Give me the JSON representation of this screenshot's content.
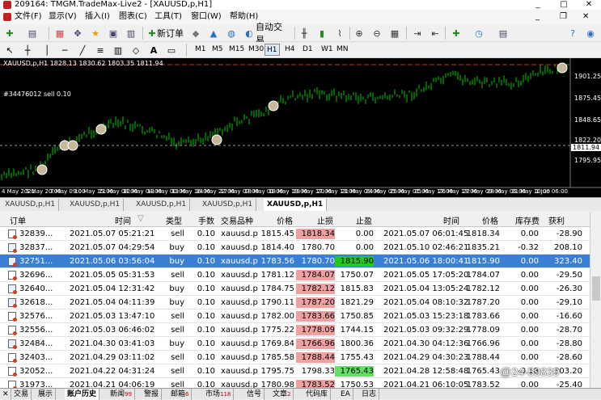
{
  "window": {
    "title": "209164: TMGM.TradeMax-Live2 - [XAUUSD,p,H1]",
    "controls": [
      "_",
      "□",
      "✕"
    ]
  },
  "menu": [
    "文件(F)",
    "显示(V)",
    "插入(I)",
    "图表(C)",
    "工具(T)",
    "窗口(W)",
    "帮助(H)"
  ],
  "toolbar": {
    "new_order": "新订单",
    "auto_trading": "自动交易"
  },
  "timeframes": [
    "M1",
    "M5",
    "M15",
    "M30",
    "H1",
    "H4",
    "D1",
    "W1",
    "MN"
  ],
  "active_timeframe": "H1",
  "chart": {
    "symbol_label": "XAUUSD,p,H1  1828.13 1830.62 1803.35 1811.94",
    "order_label": "#34476012 sell 0.10",
    "price_axis": [
      "1901.25",
      "1875.45",
      "1848.65",
      "1822.20",
      "1811.94",
      "1795.95"
    ],
    "time_axis": [
      "4 May 2021",
      "5 May 20:00",
      "7 May 09:00",
      "10 May 15:00",
      "11 May 08:00",
      "12 May 04:00",
      "13 May 00:00",
      "13 May 16:00",
      "14 May 22:00",
      "17 May 07:00",
      "18 May 01:00",
      "18 May 19:00",
      "19 May 17:00",
      "20 May 13:00",
      "21 May 09:00",
      "24 May 05:00",
      "25 May 01:00",
      "25 May 17:00",
      "26 May 13:00",
      "27 May 09:00",
      "28 May 05:00",
      "31 May 10:00",
      "1 Jun 06:00"
    ],
    "colors": {
      "candle": "#00c800",
      "current_price": "#ffffff",
      "order_line": "#d03030"
    }
  },
  "chart_tabs": [
    "XAUUSD,p,H1",
    "XAUUSD,p,H1",
    "XAUUSD,p,H1",
    "XAUUSD,p,H1",
    "XAUUSD,p,H1"
  ],
  "history": {
    "headers": [
      "订单",
      "时间",
      "类型",
      "手数",
      "交易品种",
      "价格",
      "止损",
      "止盈",
      "时间",
      "价格",
      "库存费",
      "获利"
    ],
    "rows": [
      {
        "order": "32839...",
        "open_time": "2021.05.07 05:21:21",
        "type": "sell",
        "lots": "0.10",
        "symbol": "xauusd.p",
        "price": "1815.45",
        "sl": "1818.34",
        "tp": "0.00",
        "close_time": "2021.05.07 06:01:45",
        "close_price": "1818.34",
        "swap": "0.00",
        "profit": "-28.90",
        "sl_hl": "red",
        "tp_hl": "",
        "sel": false
      },
      {
        "order": "32837...",
        "open_time": "2021.05.07 04:29:54",
        "type": "buy",
        "lots": "0.10",
        "symbol": "xauusd.p",
        "price": "1814.40",
        "sl": "1780.70",
        "tp": "0.00",
        "close_time": "2021.05.10 02:46:21",
        "close_price": "1835.21",
        "swap": "-0.32",
        "profit": "208.10",
        "sl_hl": "",
        "tp_hl": "",
        "sel": false
      },
      {
        "order": "32751...",
        "open_time": "2021.05.06 03:56:04",
        "type": "buy",
        "lots": "0.10",
        "symbol": "xauusd.p",
        "price": "1783.56",
        "sl": "1780.70",
        "tp": "1815.90",
        "close_time": "2021.05.06 18:00:41",
        "close_price": "1815.90",
        "swap": "0.00",
        "profit": "323.40",
        "sl_hl": "",
        "tp_hl": "green",
        "sel": true
      },
      {
        "order": "32696...",
        "open_time": "2021.05.05 05:31:53",
        "type": "sell",
        "lots": "0.10",
        "symbol": "xauusd.p",
        "price": "1781.12",
        "sl": "1784.07",
        "tp": "1750.07",
        "close_time": "2021.05.05 17:05:20",
        "close_price": "1784.07",
        "swap": "0.00",
        "profit": "-29.50",
        "sl_hl": "red",
        "tp_hl": "",
        "sel": false
      },
      {
        "order": "32640...",
        "open_time": "2021.05.04 12:31:42",
        "type": "buy",
        "lots": "0.10",
        "symbol": "xauusd.p",
        "price": "1784.75",
        "sl": "1782.12",
        "tp": "1815.83",
        "close_time": "2021.05.04 13:05:24",
        "close_price": "1782.12",
        "swap": "0.00",
        "profit": "-26.30",
        "sl_hl": "red",
        "tp_hl": "",
        "sel": false
      },
      {
        "order": "32618...",
        "open_time": "2021.05.04 04:11:39",
        "type": "buy",
        "lots": "0.10",
        "symbol": "xauusd.p",
        "price": "1790.11",
        "sl": "1787.20",
        "tp": "1821.29",
        "close_time": "2021.05.04 08:10:32",
        "close_price": "1787.20",
        "swap": "0.00",
        "profit": "-29.10",
        "sl_hl": "red",
        "tp_hl": "",
        "sel": false
      },
      {
        "order": "32576...",
        "open_time": "2021.05.03 13:47:10",
        "type": "sell",
        "lots": "0.10",
        "symbol": "xauusd.p",
        "price": "1782.00",
        "sl": "1783.66",
        "tp": "1750.85",
        "close_time": "2021.05.03 15:23:18",
        "close_price": "1783.66",
        "swap": "0.00",
        "profit": "-16.60",
        "sl_hl": "red",
        "tp_hl": "",
        "sel": false
      },
      {
        "order": "32556...",
        "open_time": "2021.05.03 06:46:02",
        "type": "sell",
        "lots": "0.10",
        "symbol": "xauusd.p",
        "price": "1775.22",
        "sl": "1778.09",
        "tp": "1744.15",
        "close_time": "2021.05.03 09:32:29",
        "close_price": "1778.09",
        "swap": "0.00",
        "profit": "-28.70",
        "sl_hl": "red",
        "tp_hl": "",
        "sel": false
      },
      {
        "order": "32484...",
        "open_time": "2021.04.30 03:41:03",
        "type": "buy",
        "lots": "0.10",
        "symbol": "xauusd.p",
        "price": "1769.84",
        "sl": "1766.96",
        "tp": "1800.36",
        "close_time": "2021.04.30 04:12:36",
        "close_price": "1766.96",
        "swap": "0.00",
        "profit": "-28.80",
        "sl_hl": "red",
        "tp_hl": "",
        "sel": false
      },
      {
        "order": "32403...",
        "open_time": "2021.04.29 03:11:02",
        "type": "sell",
        "lots": "0.10",
        "symbol": "xauusd.p",
        "price": "1785.58",
        "sl": "1788.44",
        "tp": "1755.43",
        "close_time": "2021.04.29 04:30:23",
        "close_price": "1788.44",
        "swap": "0.00",
        "profit": "-28.60",
        "sl_hl": "red",
        "tp_hl": "",
        "sel": false
      },
      {
        "order": "32052...",
        "open_time": "2021.04.22 04:31:24",
        "type": "sell",
        "lots": "0.10",
        "symbol": "xauusd.p",
        "price": "1795.75",
        "sl": "1798.33",
        "tp": "1765.43",
        "close_time": "2021.04.28 12:58:48",
        "close_price": "1765.43",
        "swap": "-0.18",
        "profit": "303.20",
        "sl_hl": "",
        "tp_hl": "green",
        "sel": false
      },
      {
        "order": "31973...",
        "open_time": "2021.04.21 04:06:19",
        "type": "sell",
        "lots": "0.10",
        "symbol": "xauusd.p",
        "price": "1780.98",
        "sl": "1783.52",
        "tp": "1750.53",
        "close_time": "2021.04.21 06:10:05",
        "close_price": "1783.52",
        "swap": "0.00",
        "profit": "-25.40",
        "sl_hl": "red",
        "tp_hl": "",
        "sel": false
      }
    ]
  },
  "terminal_tabs": [
    {
      "label": "交易",
      "badge": ""
    },
    {
      "label": "展示",
      "badge": ""
    },
    {
      "label": "账户历史",
      "badge": ""
    },
    {
      "label": "新闻",
      "badge": "99"
    },
    {
      "label": "警报",
      "badge": ""
    },
    {
      "label": "邮箱",
      "badge": "6"
    },
    {
      "label": "市场",
      "badge": "118"
    },
    {
      "label": "信号",
      "badge": ""
    },
    {
      "label": "文章",
      "badge": "2"
    },
    {
      "label": "代码库",
      "badge": ""
    },
    {
      "label": "EA",
      "badge": ""
    },
    {
      "label": "日志",
      "badge": ""
    }
  ],
  "active_terminal_tab": "账户历史",
  "watermark": "@24-59839"
}
